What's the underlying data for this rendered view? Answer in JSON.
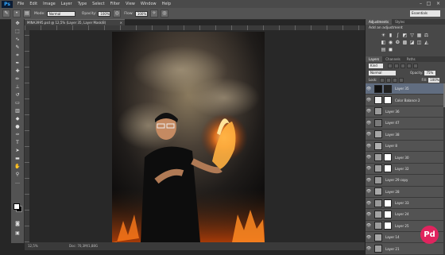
{
  "app": {
    "logo": "Ps"
  },
  "menu": [
    "File",
    "Edit",
    "Image",
    "Layer",
    "Type",
    "Select",
    "Filter",
    "View",
    "Window",
    "Help"
  ],
  "window_controls": [
    "–",
    "□",
    "×"
  ],
  "options": {
    "mode_label": "Mode:",
    "mode_value": "Normal",
    "opacity_label": "Opacity:",
    "opacity_value": "100%",
    "flow_label": "Flow:",
    "flow_value": "100%",
    "workspace": "Essentials"
  },
  "document": {
    "tab_title": "MINA3995.psd @ 12,5% (Layer 35, Layer Mask/8)",
    "zoom": "12,5%",
    "doc_info": "Doc: 70,3M/1,88G"
  },
  "adjustments": {
    "tabs": [
      "Adjustments",
      "Styles"
    ],
    "title": "Add an adjustment",
    "icons": [
      "brightness-icon",
      "levels-icon",
      "curves-icon",
      "exposure-icon",
      "vibrance-icon",
      "hue-sat-icon",
      "color-balance-icon",
      "bw-icon",
      "photo-filter-icon",
      "channel-mixer-icon",
      "color-lookup-icon",
      "invert-icon",
      "posterize-icon",
      "threshold-icon",
      "gradient-map-icon",
      "selective-color-icon"
    ]
  },
  "layers_panel": {
    "tabs": [
      "Layers",
      "Channels",
      "Paths"
    ],
    "kind": "Kind",
    "blend_mode": "Normal",
    "opacity_label": "Opacity:",
    "opacity_value": "75%",
    "lock_label": "Lock:",
    "fill_label": "Fill:",
    "fill_value": "100%",
    "layers": [
      {
        "name": "Layer 35",
        "selected": true,
        "thumb": "#111111",
        "mask": "#222222"
      },
      {
        "name": "Color Balance 2",
        "thumb": "#eeeeee",
        "mask": "#ffffff"
      },
      {
        "name": "Layer 36",
        "thumb": "#9a9a9a"
      },
      {
        "name": "Layer 47",
        "thumb": "#7a7a7a"
      },
      {
        "name": "Layer 38",
        "thumb": "#a5a5a5"
      },
      {
        "name": "Layer 8",
        "thumb": "#b0b0b0"
      },
      {
        "name": "Layer 30",
        "thumb": "#9e9e9e",
        "mask": "#ffffff"
      },
      {
        "name": "Layer 32",
        "thumb": "#a0a0a0",
        "mask": "#ffffff"
      },
      {
        "name": "Layer 29 copy",
        "thumb": "#9a9a9a"
      },
      {
        "name": "Layer 28",
        "thumb": "#a8a8a8"
      },
      {
        "name": "Layer 33",
        "thumb": "#999999",
        "mask": "#ffffff"
      },
      {
        "name": "Layer 24",
        "thumb": "#a3a3a3",
        "mask": "#ffffff"
      },
      {
        "name": "Layer 25",
        "thumb": "#9c9c9c",
        "mask": "#ffffff"
      },
      {
        "name": "Layer 14",
        "thumb": "#a6a6a6"
      },
      {
        "name": "Layer 21",
        "thumb": "#9f9f9f"
      }
    ]
  },
  "watermark": "Pd",
  "colors": {
    "accent": "#e0245e",
    "selected_layer": "#616d80"
  }
}
